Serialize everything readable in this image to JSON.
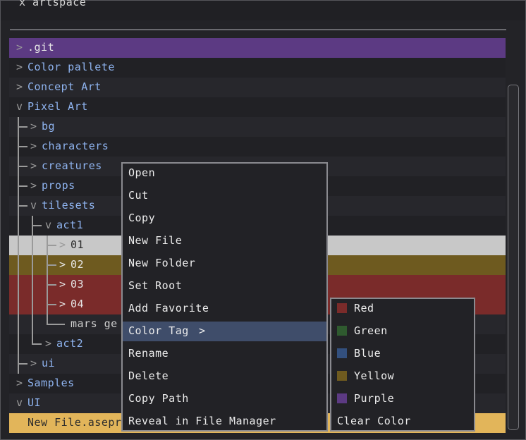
{
  "top_partial_text": "x artspace",
  "tree": {
    "git": ".git",
    "color_pallete": "Color pallete",
    "concept_art": "Concept Art",
    "pixel_art": "Pixel Art",
    "bg": "bg",
    "characters": "characters",
    "creatures": "creatures",
    "props": "props",
    "tilesets": "tilesets",
    "act1": "act1",
    "f01": "01",
    "f02": "02",
    "f03": "03",
    "f04": "04",
    "mars": "mars ge",
    "act2": "act2",
    "ui_lower": "ui",
    "samples": "Samples",
    "ui_upper": "UI",
    "newfile": "New File.asepri"
  },
  "carets": {
    "closed": ">",
    "open": "v"
  },
  "context_menu": {
    "open": "Open",
    "cut": "Cut",
    "copy": "Copy",
    "new_file": "New File",
    "new_folder": "New Folder",
    "set_root": "Set Root",
    "add_favorite": "Add Favorite",
    "color_tag": "Color Tag",
    "color_tag_arrow": ">",
    "rename": "Rename",
    "delete": "Delete",
    "copy_path": "Copy Path",
    "reveal": "Reveal in File Manager"
  },
  "color_submenu": {
    "red": "Red",
    "green": "Green",
    "blue": "Blue",
    "yellow": "Yellow",
    "purple": "Purple",
    "clear": "Clear Color"
  },
  "colors": {
    "red": "#7a2b2a",
    "green": "#2f5a2f",
    "blue": "#33507e",
    "yellow": "#6e5a1f",
    "purple": "#5c3a83",
    "highlight": "#3f4d6a",
    "folder_text": "#8fb4f0"
  }
}
